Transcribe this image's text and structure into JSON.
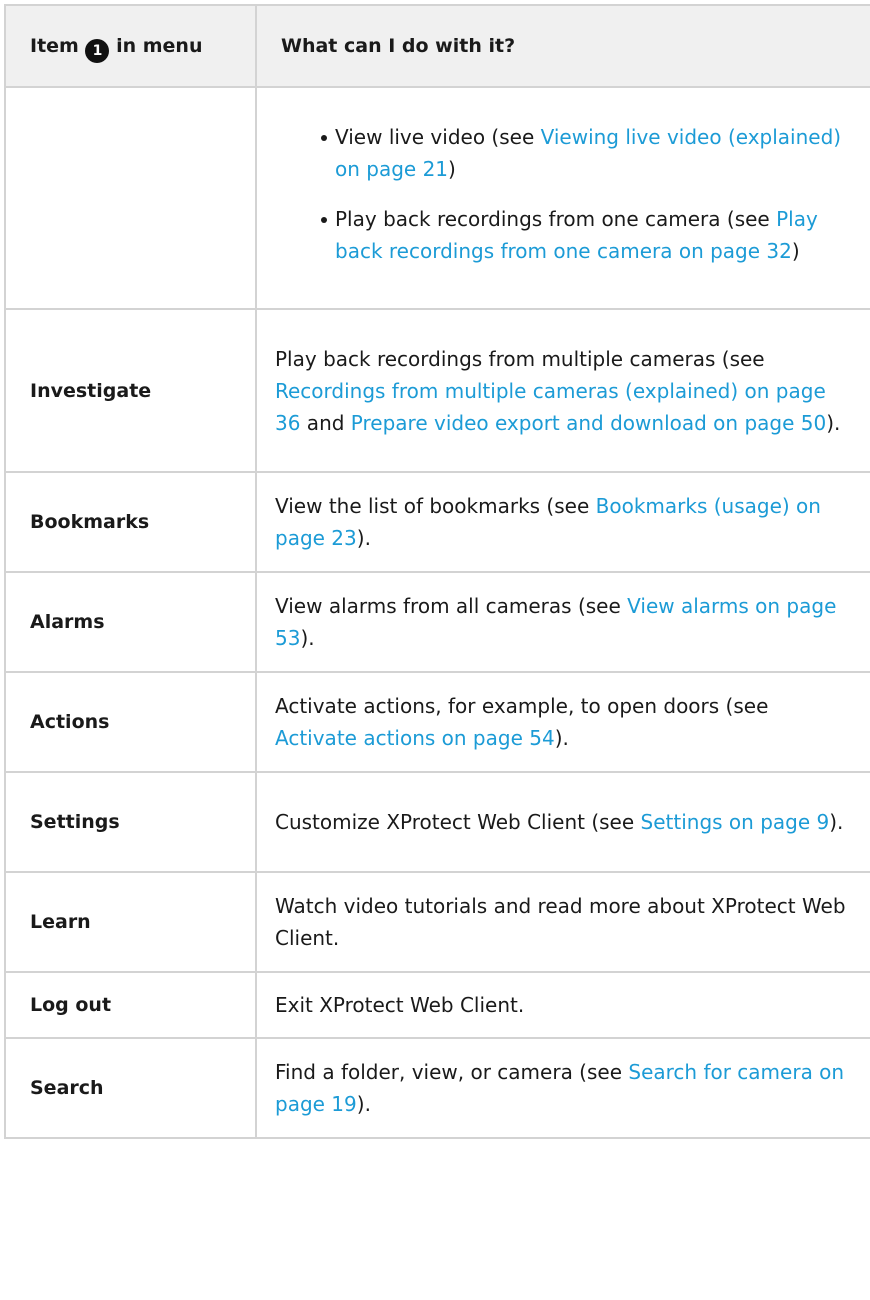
{
  "header": {
    "col1_before": "Item",
    "col1_icon": "1",
    "col1_after": "in menu",
    "col2": "What can I do with it?"
  },
  "row_continued": {
    "bullets": [
      {
        "text": "View live video (see ",
        "link": "Viewing live video (explained) on page 21",
        "after": ")"
      },
      {
        "text": "Play back recordings from one camera (see ",
        "link": "Play back recordings from one camera on page 32",
        "after": ")"
      }
    ]
  },
  "rows": [
    {
      "item": "Investigate",
      "t1": "Play back recordings from multiple cameras (see ",
      "l1": "Recordings from multiple cameras (explained) on page 36",
      "t2": " and ",
      "l2": "Prepare video export and download on page 50",
      "t3": ")."
    },
    {
      "item": "Bookmarks",
      "t1": "View the list of bookmarks (see ",
      "l1": "Bookmarks (usage) on page 23",
      "t2": ")."
    },
    {
      "item": "Alarms",
      "t1": "View alarms from all cameras (see ",
      "l1": "View alarms on page 53",
      "t2": ")."
    },
    {
      "item": "Actions",
      "t1": "Activate actions, for example, to open doors (see ",
      "l1": "Activate actions on page 54",
      "t2": ")."
    },
    {
      "item": "Settings",
      "t1": "Customize XProtect Web Client (see ",
      "l1": "Settings on page 9",
      "t2": ")."
    },
    {
      "item": "Learn",
      "t1": "Watch video tutorials and read more about XProtect Web Client."
    },
    {
      "item": "Log out",
      "t1": "Exit XProtect Web Client."
    },
    {
      "item": "Search",
      "t1": "Find a folder, view, or camera (see ",
      "l1": "Search for camera on page 19",
      "t2": ")."
    }
  ],
  "colors": {
    "link": "#1c9bd6",
    "border": "#d3d3d3",
    "header_bg": "#f0f0f0"
  }
}
